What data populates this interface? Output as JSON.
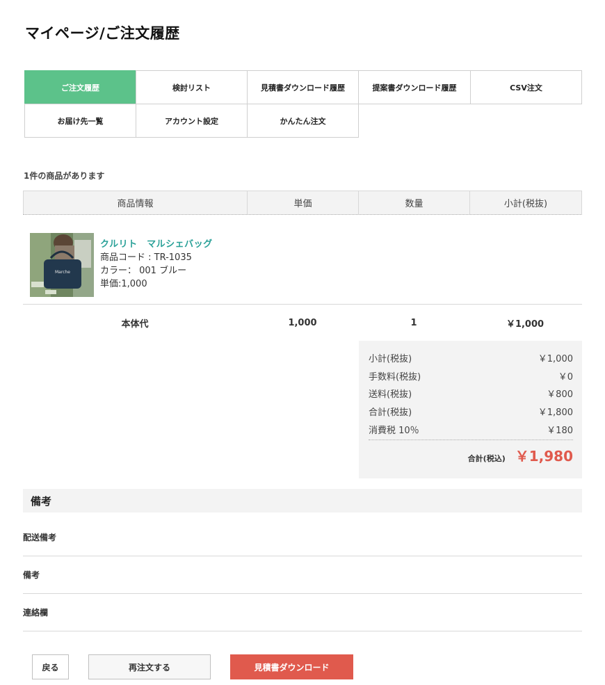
{
  "page": {
    "title": "マイページ/ご注文履歴"
  },
  "tabs": [
    {
      "label": "ご注文履歴",
      "active": true
    },
    {
      "label": "検討リスト"
    },
    {
      "label": "見積書ダウンロード履歴"
    },
    {
      "label": "提案書ダウンロード履歴"
    },
    {
      "label": "CSV注文"
    },
    {
      "label": "お届け先一覧"
    },
    {
      "label": "アカウント設定"
    },
    {
      "label": "かんたん注文"
    }
  ],
  "order": {
    "count_text": "1件の商品があります",
    "headers": [
      "商品情報",
      "単価",
      "数量",
      "小計(税抜)"
    ],
    "product": {
      "name": "クルリト　マルシェバッグ",
      "code": "商品コード : TR-1035",
      "color": "カラー： 001 ブルー",
      "unit_price": "単価:1,000"
    },
    "summary_row": {
      "label": "本体代",
      "unit_price": "1,000",
      "quantity": "1",
      "subtotal": "￥1,000"
    },
    "totals": [
      {
        "label": "小計(税抜)",
        "value": "￥1,000"
      },
      {
        "label": "手数料(税抜)",
        "value": "￥0"
      },
      {
        "label": "送料(税抜)",
        "value": "￥800"
      },
      {
        "label": "合計(税抜)",
        "value": "￥1,800"
      },
      {
        "label": "消費税 10％",
        "value": "￥180"
      }
    ],
    "grand_total": {
      "label": "合計(税込)",
      "value": "￥1,980"
    }
  },
  "notes": {
    "title": "備考",
    "rows": [
      "配送備考",
      "備考",
      "連絡欄"
    ]
  },
  "buttons": {
    "back": "戻る",
    "reorder": "再注文する",
    "download": "見積書ダウンロード"
  },
  "colors": {
    "active_tab": "#5cc28a",
    "product_link": "#2aa198",
    "accent_red": "#e05a4d",
    "panel_bg": "#f3f3f3"
  }
}
